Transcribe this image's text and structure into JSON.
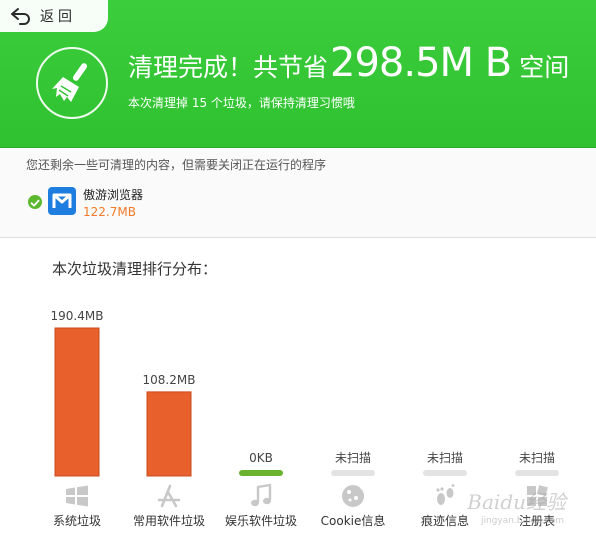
{
  "nav": {
    "back_label": "返回"
  },
  "header": {
    "headline_prefix": "清理完成！共节省",
    "amount": "298.5M B",
    "headline_suffix": "空间",
    "subline": "本次清理掉 15 个垃圾，请保持清理习惯哦"
  },
  "skipped": {
    "note": "您还剩余一些可清理的内容，但需要关闭正在运行的程序",
    "items": [
      {
        "name": "傲游浏览器",
        "size": "122.7MB",
        "icon": "maxthon-browser-icon"
      }
    ]
  },
  "ranking_title": "本次垃圾清理排行分布：",
  "colors": {
    "header_green": "#33c633",
    "bar_orange": "#e8602c",
    "zero_bar_green": "#6ab32e",
    "pending_gray": "#e3e3e3"
  },
  "chart_data": {
    "type": "bar",
    "title": "本次垃圾清理排行分布：",
    "categories": [
      "系统垃圾",
      "常用软件垃圾",
      "娱乐软件垃圾",
      "Cookie信息",
      "痕迹信息",
      "注册表"
    ],
    "values": [
      190.4,
      108.2,
      0,
      null,
      null,
      null
    ],
    "unit": "MB",
    "data_labels": [
      "190.4MB",
      "108.2MB",
      "0KB",
      "未扫描",
      "未扫描",
      "未扫描"
    ],
    "icons": [
      "windows-icon",
      "app-store-icon",
      "music-note-icon",
      "cookie-icon",
      "footprints-icon",
      "registry-blocks-icon"
    ]
  },
  "watermark": {
    "text": "Baidu经验",
    "sub": "jingyan.baidu.com"
  }
}
